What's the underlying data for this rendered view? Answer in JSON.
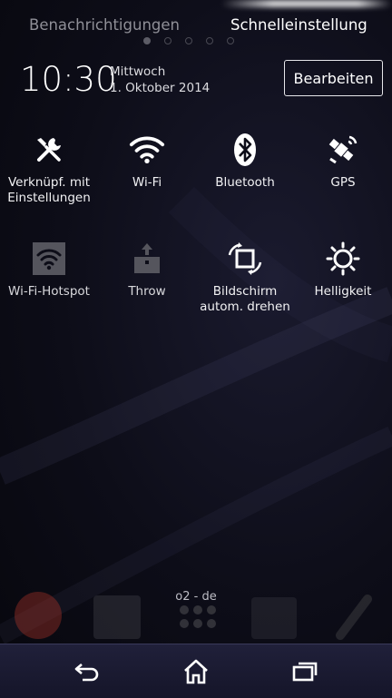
{
  "tabs": {
    "notifications": "Benachrichtigungen",
    "quick_settings": "Schnelleinstellung"
  },
  "page_indicator": {
    "count": 5,
    "active_index": 0
  },
  "header": {
    "time": "10:30",
    "weekday": "Mittwoch",
    "date": "1. Oktober 2014",
    "edit_label": "Bearbeiten"
  },
  "tiles": [
    {
      "label": "Verknüpf. mit Einstellungen",
      "icon": "tools-icon",
      "enabled": true
    },
    {
      "label": "Wi-Fi",
      "icon": "wifi-icon",
      "enabled": true
    },
    {
      "label": "Bluetooth",
      "icon": "bluetooth-icon",
      "enabled": true
    },
    {
      "label": "GPS",
      "icon": "gps-icon",
      "enabled": true
    },
    {
      "label": "Wi-Fi-Hotspot",
      "icon": "hotspot-icon",
      "enabled": false
    },
    {
      "label": "Throw",
      "icon": "throw-icon",
      "enabled": false
    },
    {
      "label": "Bildschirm autom. drehen",
      "icon": "rotate-icon",
      "enabled": true
    },
    {
      "label": "Helligkeit",
      "icon": "brightness-icon",
      "enabled": true
    }
  ],
  "operator": "o2 - de",
  "navbar": {
    "back": "back-icon",
    "home": "home-icon",
    "recents": "recents-icon"
  },
  "colors": {
    "background": "#0d0d18",
    "navbar": "#1a1a33",
    "inactive_icon": "#55555d"
  }
}
